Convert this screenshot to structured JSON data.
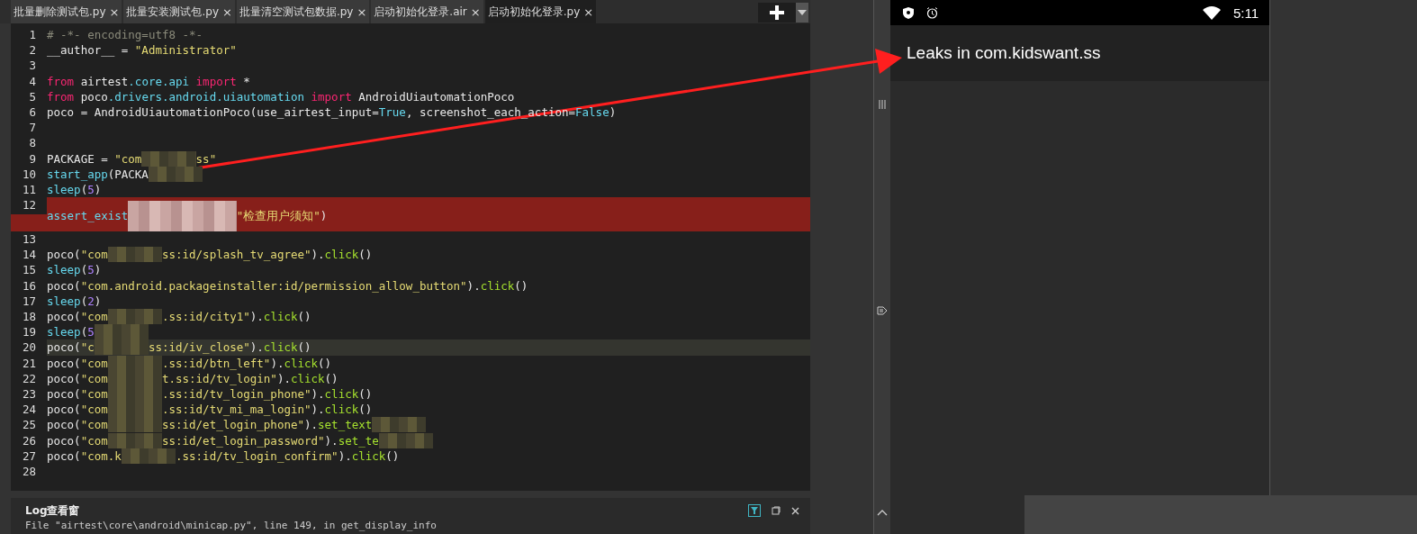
{
  "tabs": [
    {
      "label": "批量删除测试包.py",
      "selected": false
    },
    {
      "label": "批量安装测试包.py",
      "selected": false
    },
    {
      "label": "批量清空测试包数据.py",
      "selected": false
    },
    {
      "label": "启动初始化登录.air",
      "selected": false
    },
    {
      "label": "启动初始化登录.py",
      "selected": true
    }
  ],
  "tab_close": "×",
  "editor": {
    "lines": [
      {
        "number": "1",
        "kind": "code",
        "tokens": [
          {
            "kind": "comment",
            "text": "# -*- encoding=utf8 -*-"
          }
        ]
      },
      {
        "number": "2",
        "kind": "code",
        "tokens": [
          {
            "kind": "plain",
            "text": "__author__ = "
          },
          {
            "kind": "string",
            "text": "\"Administrator\""
          }
        ]
      },
      {
        "number": "3",
        "kind": "code"
      },
      {
        "number": "4",
        "kind": "code",
        "tokens": [
          {
            "kind": "keyword",
            "text": "from"
          },
          {
            "kind": "plain",
            "text": " airtest"
          },
          {
            "kind": "builtin",
            "text": ".core.api"
          },
          {
            "kind": "keyword",
            "text": " import"
          },
          {
            "kind": "plain",
            "text": " *"
          }
        ]
      },
      {
        "number": "5",
        "kind": "code",
        "tokens": [
          {
            "kind": "keyword",
            "text": "from"
          },
          {
            "kind": "plain",
            "text": " poco"
          },
          {
            "kind": "builtin",
            "text": ".drivers.android.uiautomation"
          },
          {
            "kind": "keyword",
            "text": " import"
          },
          {
            "kind": "plain",
            "text": " AndroidUiautomationPoco"
          }
        ]
      },
      {
        "number": "6",
        "kind": "code",
        "tokens": [
          {
            "kind": "plain",
            "text": "poco = AndroidUiautomationPoco(use_airtest_input="
          },
          {
            "kind": "builtin",
            "text": "True"
          },
          {
            "kind": "plain",
            "text": ", screenshot_each_action="
          },
          {
            "kind": "builtin",
            "text": "False"
          },
          {
            "kind": "plain",
            "text": ")"
          }
        ]
      },
      {
        "number": "7",
        "kind": "code"
      },
      {
        "number": "8",
        "kind": "code"
      },
      {
        "number": "9",
        "kind": "code",
        "tokens": [
          {
            "kind": "plain",
            "text": "PACKAGE = "
          },
          {
            "kind": "string",
            "text": "\"com"
          },
          {
            "kind": "redacted"
          },
          {
            "kind": "string",
            "text": "ss\""
          }
        ]
      },
      {
        "number": "10",
        "kind": "code",
        "tokens": [
          {
            "kind": "builtin",
            "text": "start_app"
          },
          {
            "kind": "plain",
            "text": "(PACKA"
          },
          {
            "kind": "redacted"
          }
        ]
      },
      {
        "number": "11",
        "kind": "code",
        "tokens": [
          {
            "kind": "builtin",
            "text": "sleep"
          },
          {
            "kind": "plain",
            "text": "("
          },
          {
            "kind": "number",
            "text": "5"
          },
          {
            "kind": "plain",
            "text": ")"
          }
        ]
      },
      {
        "number": "12",
        "kind": "error",
        "tokens": [
          {
            "kind": "builtin",
            "text": "assert_exist"
          },
          {
            "kind": "redacted"
          },
          {
            "kind": "string",
            "text": "\"检查用户须知\""
          },
          {
            "kind": "plain",
            "text": ")"
          }
        ]
      },
      {
        "number": "13",
        "kind": "code"
      },
      {
        "number": "14",
        "kind": "code",
        "tokens": [
          {
            "kind": "plain",
            "text": "poco("
          },
          {
            "kind": "string",
            "text": "\"com"
          },
          {
            "kind": "redacted"
          },
          {
            "kind": "string",
            "text": "ss:id/splash_tv_agree\""
          },
          {
            "kind": "plain",
            "text": ")."
          },
          {
            "kind": "method",
            "text": "click"
          },
          {
            "kind": "plain",
            "text": "()"
          }
        ]
      },
      {
        "number": "15",
        "kind": "code",
        "tokens": [
          {
            "kind": "builtin",
            "text": "sleep"
          },
          {
            "kind": "plain",
            "text": "("
          },
          {
            "kind": "number",
            "text": "5"
          },
          {
            "kind": "plain",
            "text": ")"
          }
        ]
      },
      {
        "number": "16",
        "kind": "code",
        "tokens": [
          {
            "kind": "plain",
            "text": "poco("
          },
          {
            "kind": "string",
            "text": "\"com.android.packageinstaller:id/permission_allow_button\""
          },
          {
            "kind": "plain",
            "text": ")."
          },
          {
            "kind": "method",
            "text": "click"
          },
          {
            "kind": "plain",
            "text": "()"
          }
        ]
      },
      {
        "number": "17",
        "kind": "code",
        "tokens": [
          {
            "kind": "builtin",
            "text": "sleep"
          },
          {
            "kind": "plain",
            "text": "("
          },
          {
            "kind": "number",
            "text": "2"
          },
          {
            "kind": "plain",
            "text": ")"
          }
        ]
      },
      {
        "number": "18",
        "kind": "code",
        "tokens": [
          {
            "kind": "plain",
            "text": "poco("
          },
          {
            "kind": "string",
            "text": "\"com"
          },
          {
            "kind": "redacted"
          },
          {
            "kind": "string",
            "text": ".ss:id/city1\""
          },
          {
            "kind": "plain",
            "text": ")."
          },
          {
            "kind": "method",
            "text": "click"
          },
          {
            "kind": "plain",
            "text": "()"
          }
        ]
      },
      {
        "number": "19",
        "kind": "code",
        "tokens": [
          {
            "kind": "builtin",
            "text": "sleep"
          },
          {
            "kind": "plain",
            "text": "("
          },
          {
            "kind": "number",
            "text": "5"
          },
          {
            "kind": "redacted"
          }
        ]
      },
      {
        "number": "20",
        "kind": "current",
        "tokens": [
          {
            "kind": "plain",
            "text": "poco("
          },
          {
            "kind": "string",
            "text": "\"c"
          },
          {
            "kind": "redacted"
          },
          {
            "kind": "string",
            "text": "ss:id/iv_close\""
          },
          {
            "kind": "plain",
            "text": ")."
          },
          {
            "kind": "method",
            "text": "click"
          },
          {
            "kind": "plain",
            "text": "()"
          }
        ]
      },
      {
        "number": "21",
        "kind": "code",
        "tokens": [
          {
            "kind": "plain",
            "text": "poco("
          },
          {
            "kind": "string",
            "text": "\"com"
          },
          {
            "kind": "redacted"
          },
          {
            "kind": "string",
            "text": ".ss:id/btn_left\""
          },
          {
            "kind": "plain",
            "text": ")."
          },
          {
            "kind": "method",
            "text": "click"
          },
          {
            "kind": "plain",
            "text": "()"
          }
        ]
      },
      {
        "number": "22",
        "kind": "code",
        "tokens": [
          {
            "kind": "plain",
            "text": "poco("
          },
          {
            "kind": "string",
            "text": "\"com"
          },
          {
            "kind": "redacted"
          },
          {
            "kind": "string",
            "text": "t.ss:id/tv_login\""
          },
          {
            "kind": "plain",
            "text": ")."
          },
          {
            "kind": "method",
            "text": "click"
          },
          {
            "kind": "plain",
            "text": "()"
          }
        ]
      },
      {
        "number": "23",
        "kind": "code",
        "tokens": [
          {
            "kind": "plain",
            "text": "poco("
          },
          {
            "kind": "string",
            "text": "\"com"
          },
          {
            "kind": "redacted"
          },
          {
            "kind": "string",
            "text": ".ss:id/tv_login_phone\""
          },
          {
            "kind": "plain",
            "text": ")."
          },
          {
            "kind": "method",
            "text": "click"
          },
          {
            "kind": "plain",
            "text": "()"
          }
        ]
      },
      {
        "number": "24",
        "kind": "code",
        "tokens": [
          {
            "kind": "plain",
            "text": "poco("
          },
          {
            "kind": "string",
            "text": "\"com"
          },
          {
            "kind": "redacted"
          },
          {
            "kind": "string",
            "text": ".ss:id/tv_mi_ma_login\""
          },
          {
            "kind": "plain",
            "text": ")."
          },
          {
            "kind": "method",
            "text": "click"
          },
          {
            "kind": "plain",
            "text": "()"
          }
        ]
      },
      {
        "number": "25",
        "kind": "code",
        "tokens": [
          {
            "kind": "plain",
            "text": "poco("
          },
          {
            "kind": "string",
            "text": "\"com"
          },
          {
            "kind": "redacted"
          },
          {
            "kind": "string",
            "text": "ss:id/et_login_phone\""
          },
          {
            "kind": "plain",
            "text": ")."
          },
          {
            "kind": "method",
            "text": "set_text"
          },
          {
            "kind": "redacted"
          }
        ]
      },
      {
        "number": "26",
        "kind": "code",
        "tokens": [
          {
            "kind": "plain",
            "text": "poco("
          },
          {
            "kind": "string",
            "text": "\"com"
          },
          {
            "kind": "redacted"
          },
          {
            "kind": "string",
            "text": "ss:id/et_login_password\""
          },
          {
            "kind": "plain",
            "text": ")."
          },
          {
            "kind": "method",
            "text": "set_te"
          },
          {
            "kind": "redacted"
          }
        ]
      },
      {
        "number": "27",
        "kind": "code",
        "tokens": [
          {
            "kind": "plain",
            "text": "poco("
          },
          {
            "kind": "string",
            "text": "\"com.k"
          },
          {
            "kind": "redacted"
          },
          {
            "kind": "string",
            "text": ".ss:id/tv_login_confirm\""
          },
          {
            "kind": "plain",
            "text": ")."
          },
          {
            "kind": "method",
            "text": "click"
          },
          {
            "kind": "plain",
            "text": "()"
          }
        ]
      },
      {
        "number": "28",
        "kind": "code"
      }
    ]
  },
  "log_panel": {
    "title": "Log查看窗",
    "line": "File \"airtest\\core\\android\\minicap.py\", line 149, in get_display_info"
  },
  "device": {
    "time": "5:11",
    "app_title": "Leaks in com.kidswant.ss"
  }
}
